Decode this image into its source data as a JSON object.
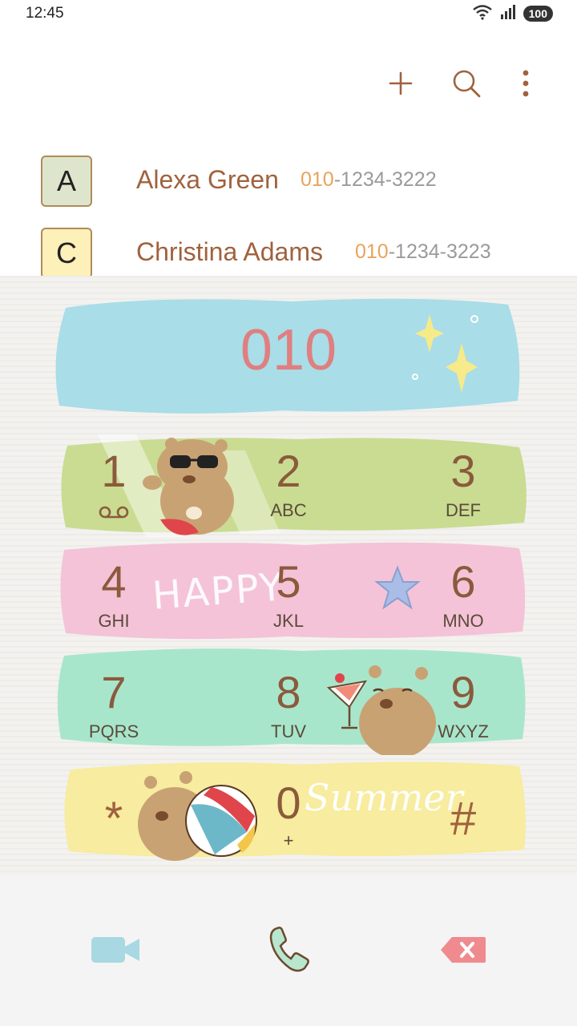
{
  "status": {
    "time": "12:45",
    "battery": "100"
  },
  "toolbar": {
    "add_icon": "plus-icon",
    "search_icon": "search-icon",
    "more_icon": "more-vert-icon"
  },
  "contacts": [
    {
      "initial": "A",
      "name": "Alexa Green",
      "number_match": "010",
      "number_rest": "-1234-3222",
      "avatar_color": "#dde6cc"
    },
    {
      "initial": "C",
      "name": "Christina Adams",
      "number_match": "010",
      "number_rest": "-1234-3223",
      "avatar_color": "#fdf0b8"
    }
  ],
  "dialer": {
    "input": "010",
    "keys": [
      {
        "digit": "1",
        "letters": ""
      },
      {
        "digit": "2",
        "letters": "ABC"
      },
      {
        "digit": "3",
        "letters": "DEF"
      },
      {
        "digit": "4",
        "letters": "GHI"
      },
      {
        "digit": "5",
        "letters": "JKL"
      },
      {
        "digit": "6",
        "letters": "MNO"
      },
      {
        "digit": "7",
        "letters": "PQRS"
      },
      {
        "digit": "8",
        "letters": "TUV"
      },
      {
        "digit": "9",
        "letters": "WXYZ"
      },
      {
        "digit": "*",
        "letters": ""
      },
      {
        "digit": "0",
        "letters": "+"
      },
      {
        "digit": "#",
        "letters": ""
      }
    ],
    "decor_happy": "HAPPY",
    "decor_summer": "Summer"
  },
  "actions": {
    "video_icon": "video-call-icon",
    "call_icon": "phone-icon",
    "delete_icon": "backspace-icon"
  },
  "colors": {
    "display_band": "#a9dde8",
    "row1": "#c9dc92",
    "row2": "#f4c3d8",
    "row3": "#a8e6cc",
    "row4": "#f7ec9f",
    "digit": "#8b5a3c",
    "accent": "#e07f7f"
  }
}
